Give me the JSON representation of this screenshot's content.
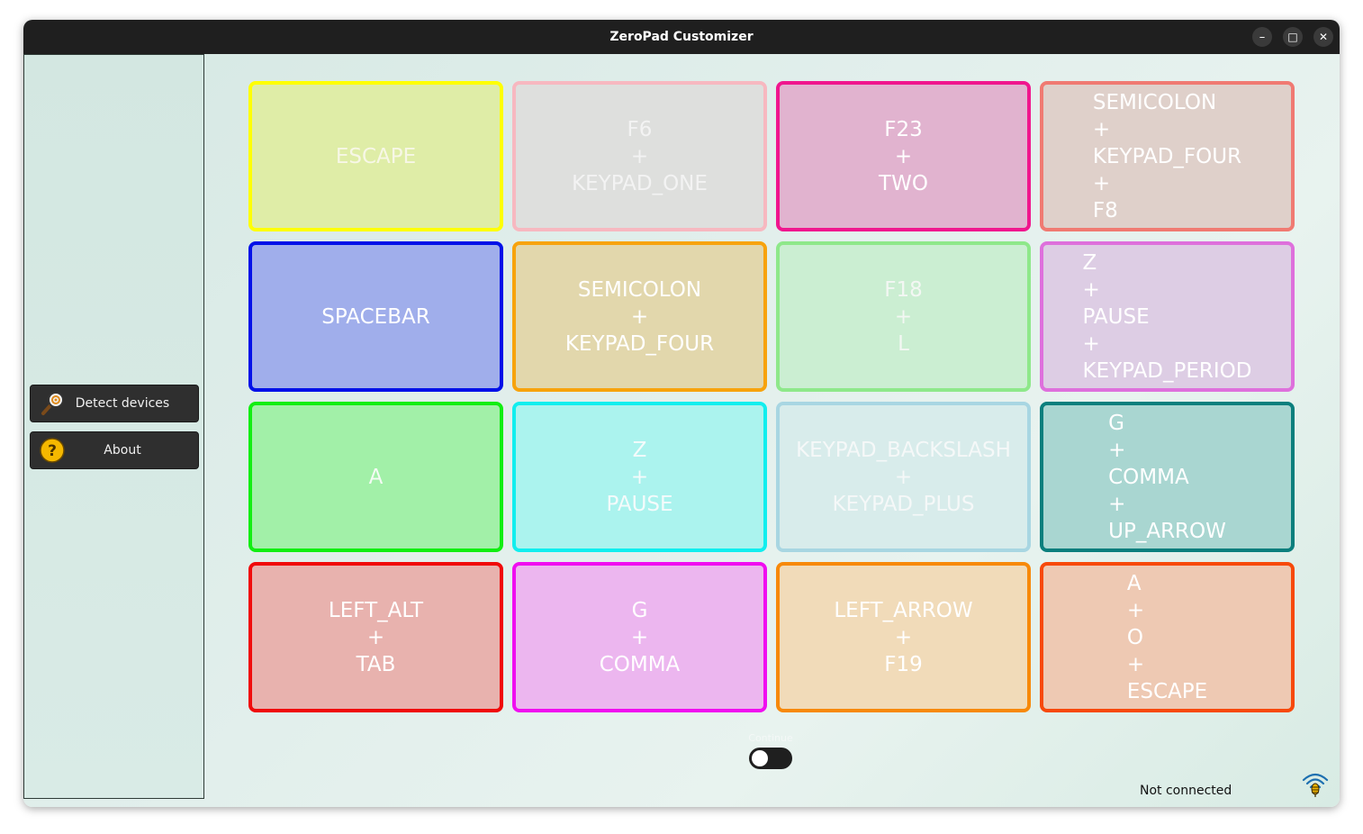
{
  "window": {
    "title": "ZeroPad Customizer",
    "controls": {
      "minimize": "–",
      "maximize": "□",
      "close": "✕"
    }
  },
  "sidebar": {
    "items": [
      {
        "label": "Detect devices",
        "icon": "magnifier-icon"
      },
      {
        "label": "About",
        "icon": "help-icon"
      }
    ]
  },
  "keys": [
    {
      "lines": [
        "ESCAPE"
      ],
      "border": "#ffff00",
      "fill": "#dfeda7",
      "align": "center",
      "text_color": "#f7f7e6"
    },
    {
      "lines": [
        "F6",
        "+",
        "KEYPAD_ONE"
      ],
      "border": "#f7b8c0",
      "fill": "#dedfdd",
      "align": "center",
      "text_color": "#f3f3f3"
    },
    {
      "lines": [
        "F23",
        "+",
        "TWO"
      ],
      "border": "#f0168e",
      "fill": "#e1b3cf",
      "align": "center",
      "text_color": "#ffffff"
    },
    {
      "lines": [
        "SEMICOLON",
        "+",
        "KEYPAD_FOUR",
        "+",
        "F8"
      ],
      "border": "#f07a72",
      "fill": "#dfd0ca",
      "align": "left",
      "text_color": "#ffffff"
    },
    {
      "lines": [
        "SPACEBAR"
      ],
      "border": "#0010e8",
      "fill": "#a0aeeb",
      "align": "center",
      "text_color": "#ffffff"
    },
    {
      "lines": [
        "SEMICOLON",
        "+",
        "KEYPAD_FOUR"
      ],
      "border": "#f7a30d",
      "fill": "#e2d7ac",
      "align": "center",
      "text_color": "#ffffff"
    },
    {
      "lines": [
        "F18",
        "+",
        "L"
      ],
      "border": "#8ee88a",
      "fill": "#cbeed2",
      "align": "center",
      "text_color": "#f3f7f3"
    },
    {
      "lines": [
        "Z",
        "+",
        "PAUSE",
        "+",
        "KEYPAD_PERIOD"
      ],
      "border": "#de70dc",
      "fill": "#ddcde4",
      "align": "left",
      "text_color": "#ffffff"
    },
    {
      "lines": [
        "A"
      ],
      "border": "#11ee11",
      "fill": "#a2f0a8",
      "align": "center",
      "text_color": "#f4fbf4"
    },
    {
      "lines": [
        "Z",
        "+",
        "PAUSE"
      ],
      "border": "#11eeee",
      "fill": "#abf3ee",
      "align": "center",
      "text_color": "#f4fbfb"
    },
    {
      "lines": [
        "KEYPAD_BACKSLASH",
        "+",
        "KEYPAD_PLUS"
      ],
      "border": "#a8d6e2",
      "fill": "#d8eceb",
      "align": "center",
      "text_color": "#f5f8f8"
    },
    {
      "lines": [
        "G",
        "+",
        "COMMA",
        "+",
        "UP_ARROW"
      ],
      "border": "#0a7f7d",
      "fill": "#a9d6d1",
      "align": "left",
      "text_color": "#ffffff"
    },
    {
      "lines": [
        "LEFT_ALT",
        "+",
        "TAB"
      ],
      "border": "#f00a0a",
      "fill": "#e8b2ae",
      "align": "center",
      "text_color": "#ffffff"
    },
    {
      "lines": [
        "G",
        "+",
        "COMMA"
      ],
      "border": "#f00ef0",
      "fill": "#ecb6ef",
      "align": "center",
      "text_color": "#ffffff"
    },
    {
      "lines": [
        "LEFT_ARROW",
        "+",
        "F19"
      ],
      "border": "#f7890a",
      "fill": "#f1dbb9",
      "align": "center",
      "text_color": "#ffffff"
    },
    {
      "lines": [
        "A",
        "+",
        "O",
        "+",
        "ESCAPE"
      ],
      "border": "#f7490a",
      "fill": "#eec9b3",
      "align": "left",
      "text_color": "#ffffff"
    }
  ],
  "toggle": {
    "label": "Continue",
    "state": false
  },
  "status": {
    "text": "Not connected",
    "icon": "wifi-bug-icon"
  }
}
